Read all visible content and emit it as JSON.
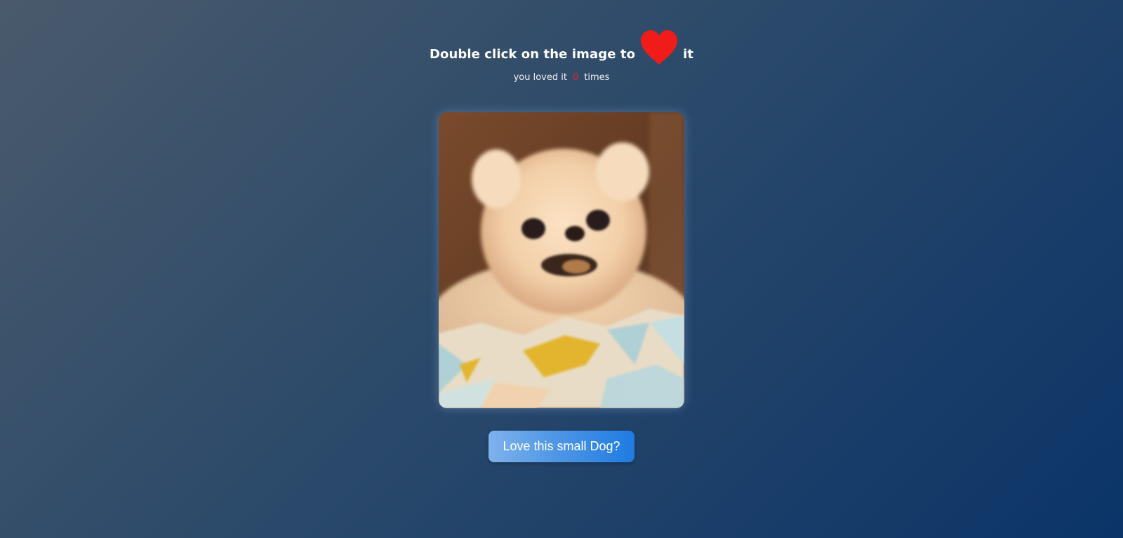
{
  "header": {
    "title_prefix": "Double click on the image to",
    "title_suffix": "it",
    "heart_icon": "heart-icon",
    "heart_color": "#ef1c1a"
  },
  "counter": {
    "prefix": "you loved it",
    "count": "0",
    "suffix": "times",
    "count_color": "#e8241d"
  },
  "photo": {
    "subject": "small-white-dog-photo"
  },
  "button": {
    "label": "Love this small Dog?"
  }
}
